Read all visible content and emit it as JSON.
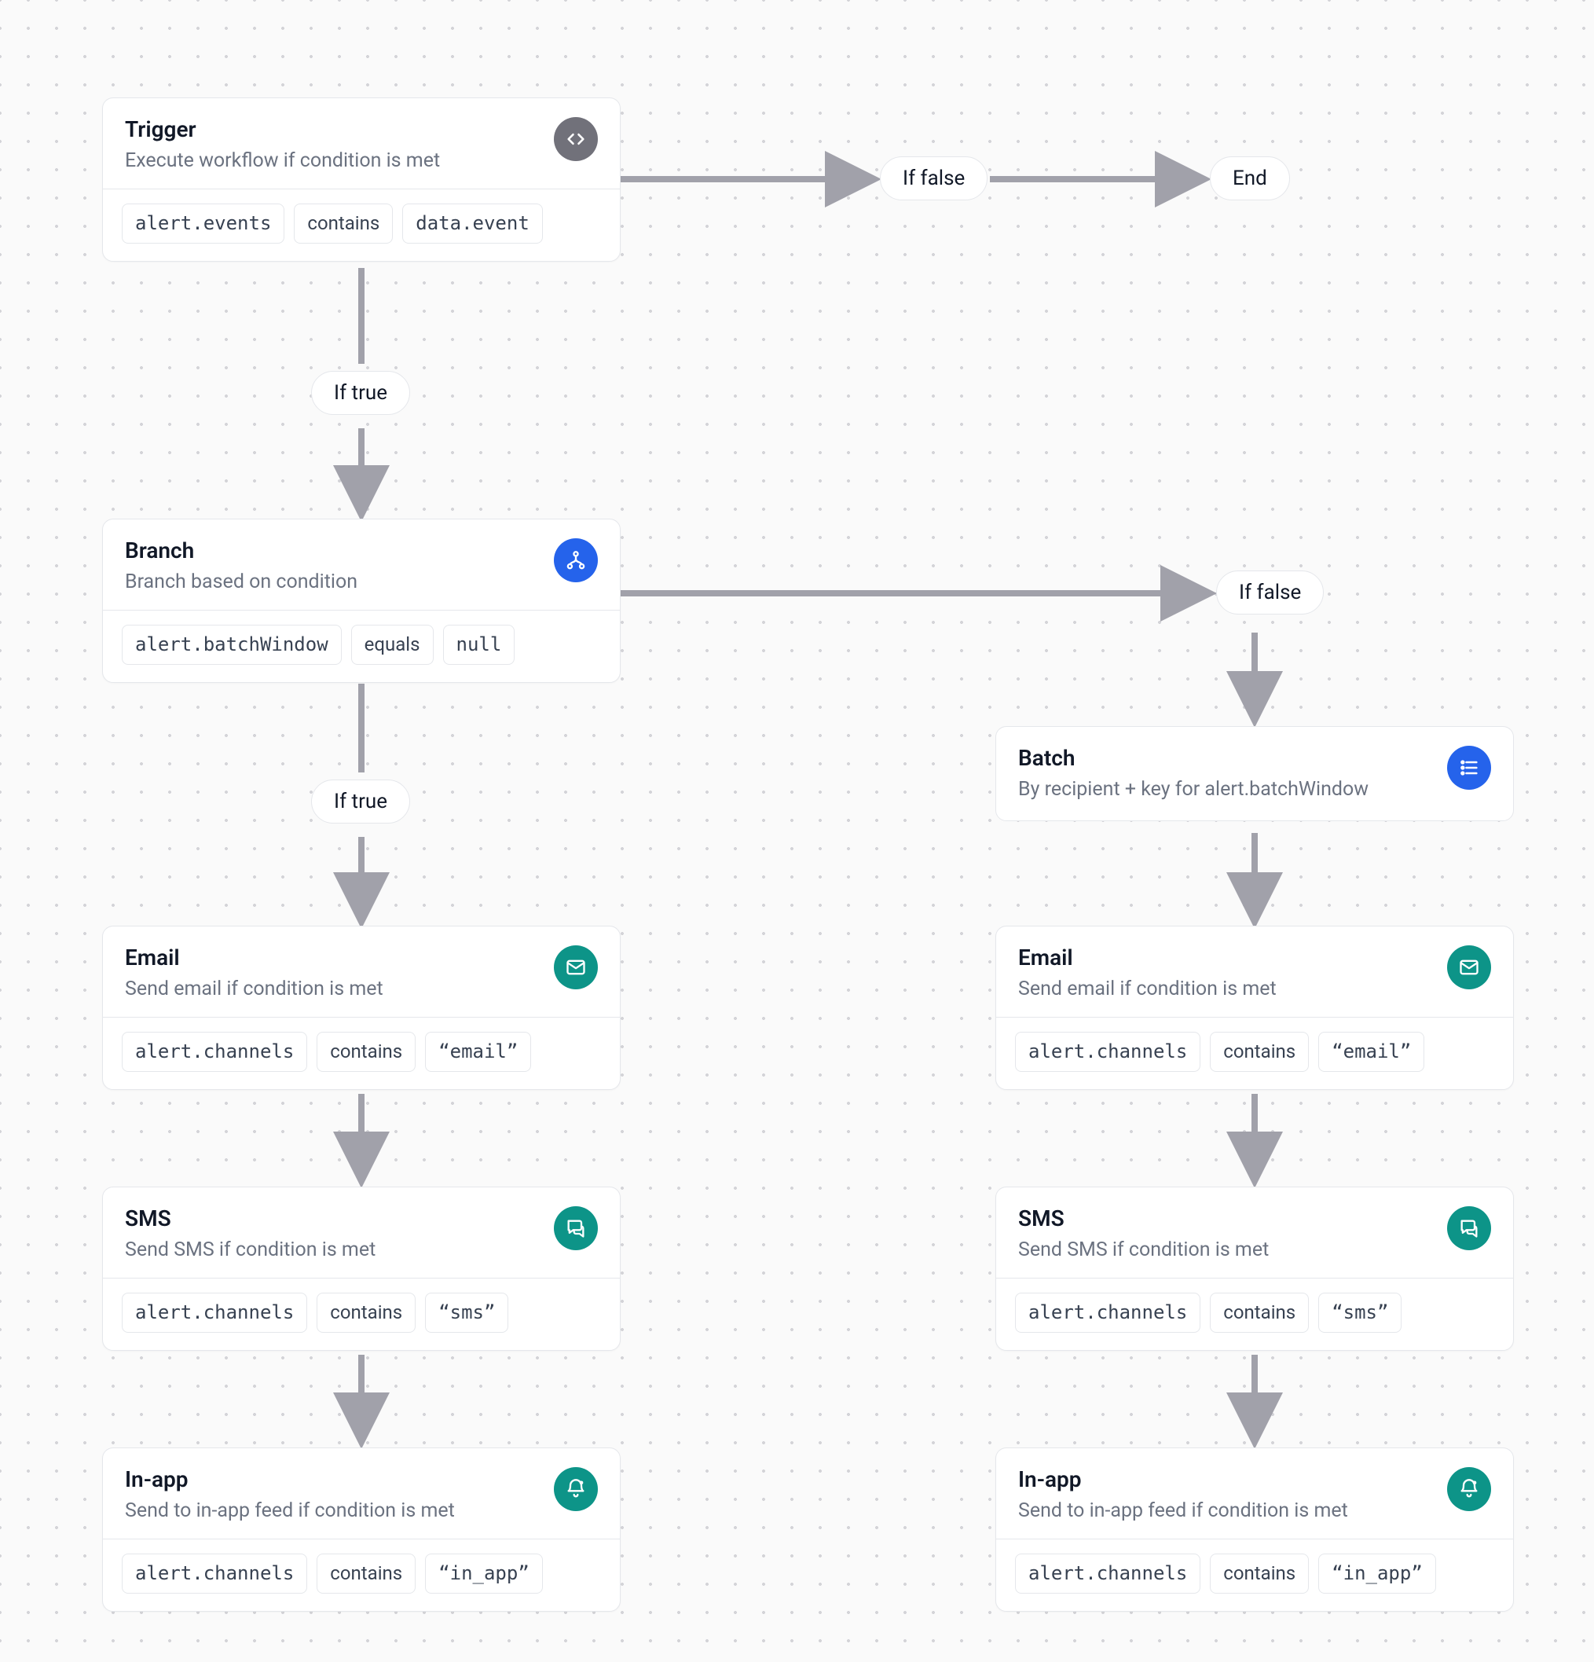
{
  "labels": {
    "if_true": "If true",
    "if_false": "If false",
    "end": "End"
  },
  "nodes": {
    "trigger": {
      "title": "Trigger",
      "subtitle": "Execute workflow if condition is met",
      "cond": {
        "left": "alert.events",
        "op": "contains",
        "right": "data.event"
      }
    },
    "branch": {
      "title": "Branch",
      "subtitle": "Branch based on condition",
      "cond": {
        "left": "alert.batchWindow",
        "op": "equals",
        "right": "null"
      }
    },
    "batch": {
      "title": "Batch",
      "subtitle": "By recipient + key for alert.batchWindow"
    },
    "email_l": {
      "title": "Email",
      "subtitle": "Send email if condition is met",
      "cond": {
        "left": "alert.channels",
        "op": "contains",
        "right": "“email”"
      }
    },
    "email_r": {
      "title": "Email",
      "subtitle": "Send email if condition is met",
      "cond": {
        "left": "alert.channels",
        "op": "contains",
        "right": "“email”"
      }
    },
    "sms_l": {
      "title": "SMS",
      "subtitle": "Send SMS if condition is met",
      "cond": {
        "left": "alert.channels",
        "op": "contains",
        "right": "“sms”"
      }
    },
    "sms_r": {
      "title": "SMS",
      "subtitle": "Send SMS if condition is met",
      "cond": {
        "left": "alert.channels",
        "op": "contains",
        "right": "“sms”"
      }
    },
    "inapp_l": {
      "title": "In-app",
      "subtitle": "Send to in-app feed if condition is met",
      "cond": {
        "left": "alert.channels",
        "op": "contains",
        "right": "“in_app”"
      }
    },
    "inapp_r": {
      "title": "In-app",
      "subtitle": "Send to in-app feed if condition is met",
      "cond": {
        "left": "alert.channels",
        "op": "contains",
        "right": "“in_app”"
      }
    }
  }
}
